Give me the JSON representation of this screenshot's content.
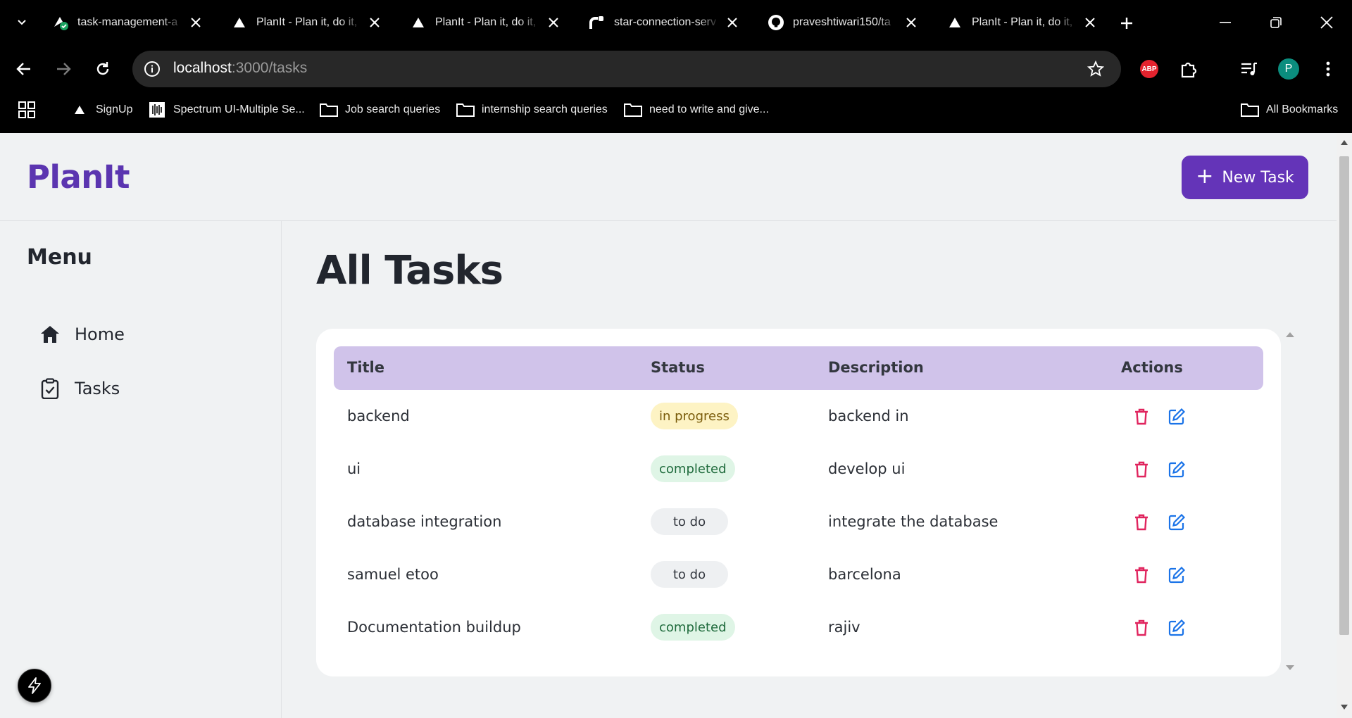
{
  "browser": {
    "tabs": [
      {
        "title": "task-management-a",
        "icon": "vercel-deploy-icon"
      },
      {
        "title": "PlanIt - Plan it, do it,",
        "icon": "triangle-icon"
      },
      {
        "title": "PlanIt - Plan it, do it,",
        "icon": "triangle-icon"
      },
      {
        "title": "star-connection-serv",
        "icon": "render-icon"
      },
      {
        "title": "praveshtiwari150/ta",
        "icon": "github-icon"
      },
      {
        "title": "PlanIt - Plan it, do it,",
        "icon": "triangle-icon"
      }
    ],
    "url_host": "localhost",
    "url_path": ":3000/tasks",
    "extension_abp_label": "ABP",
    "profile_initial": "P",
    "bookmarks": [
      {
        "label": "SignUp",
        "icon": "triangle-icon"
      },
      {
        "label": "Spectrum UI-Multiple Se...",
        "icon": "spectrum-icon"
      },
      {
        "label": "Job search queries",
        "icon": "folder-icon"
      },
      {
        "label": "internship search queries",
        "icon": "folder-icon"
      },
      {
        "label": "need to write and give...",
        "icon": "folder-icon"
      }
    ],
    "all_bookmarks_label": "All Bookmarks"
  },
  "app": {
    "brand": "PlanIt",
    "new_task_label": "New Task",
    "menu_title": "Menu",
    "menu": [
      {
        "label": "Home",
        "icon": "home-icon"
      },
      {
        "label": "Tasks",
        "icon": "clipboard-check-icon"
      }
    ],
    "page_title": "All Tasks",
    "table": {
      "columns": [
        "Title",
        "Status",
        "Description",
        "Actions"
      ],
      "rows": [
        {
          "title": "backend",
          "status": "in progress",
          "status_kind": "inprog",
          "description": "backend in"
        },
        {
          "title": "ui",
          "status": "completed",
          "status_kind": "done",
          "description": "develop ui"
        },
        {
          "title": "database integration",
          "status": "to do",
          "status_kind": "todo",
          "description": "integrate the database"
        },
        {
          "title": "samuel etoo",
          "status": "to do",
          "status_kind": "todo",
          "description": "barcelona"
        },
        {
          "title": "Documentation buildup",
          "status": "completed",
          "status_kind": "done",
          "description": "rajiv"
        }
      ]
    }
  },
  "colors": {
    "brand": "#5b35b0",
    "primary_button": "#6434b8",
    "table_header": "#d0c3ea",
    "delete": "#e0245e",
    "edit": "#1a73e8"
  }
}
